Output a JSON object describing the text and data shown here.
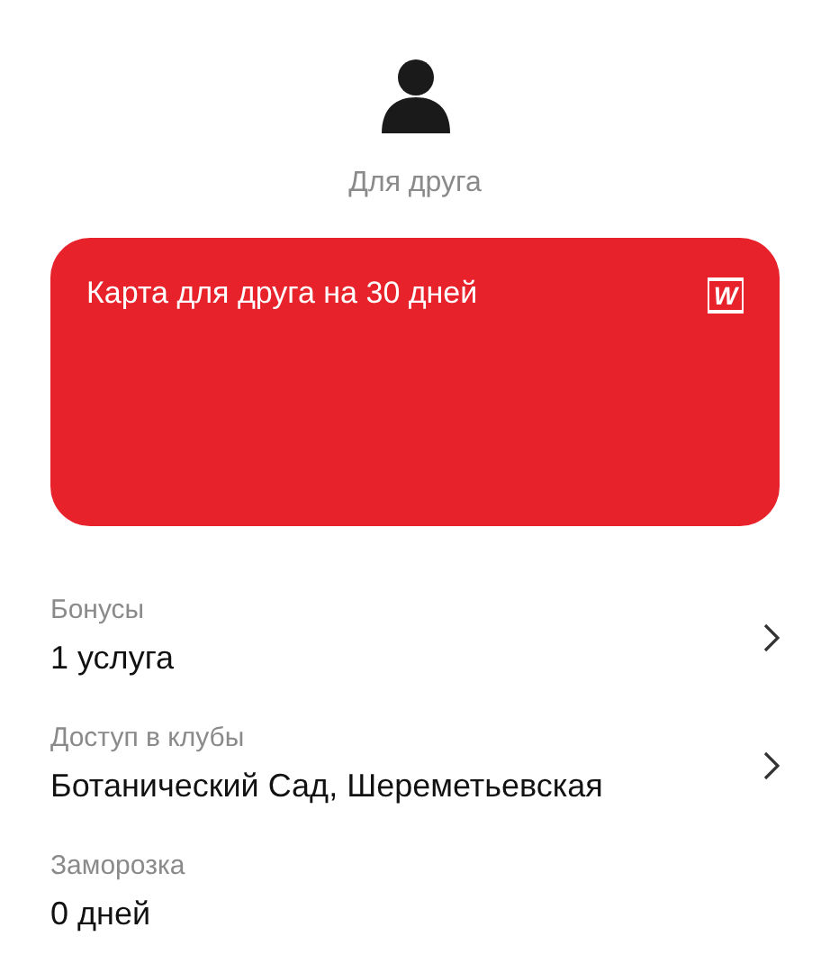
{
  "profile": {
    "label": "Для друга"
  },
  "card": {
    "title": "Карта для друга на 30 дней",
    "logo": "W"
  },
  "rows": [
    {
      "label": "Бонусы",
      "value": "1 услуга",
      "chevron": true
    },
    {
      "label": "Доступ в клубы",
      "value": "Ботанический Сад, Шереметьевская",
      "chevron": true
    },
    {
      "label": "Заморозка",
      "value": "0 дней",
      "chevron": false
    }
  ]
}
